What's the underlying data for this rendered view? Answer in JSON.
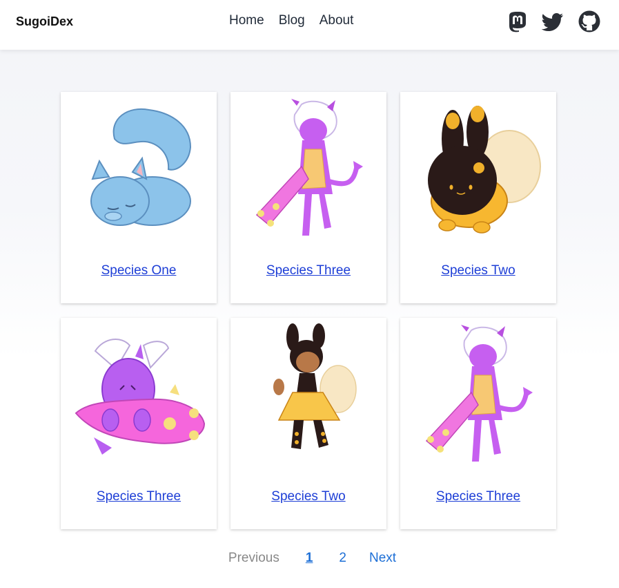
{
  "header": {
    "brand": "SugoiDex",
    "nav": [
      {
        "label": "Home"
      },
      {
        "label": "Blog"
      },
      {
        "label": "About"
      }
    ],
    "social_icons": [
      "mastodon-icon",
      "twitter-icon",
      "github-icon"
    ]
  },
  "cards": [
    {
      "title": "Species One",
      "image": "blue-cat-creature-illustration"
    },
    {
      "title": "Species Three",
      "image": "purple-horned-creature-with-club-illustration"
    },
    {
      "title": "Species Two",
      "image": "black-bunny-bee-creature-illustration"
    },
    {
      "title": "Species Three",
      "image": "purple-creature-hugging-club-illustration"
    },
    {
      "title": "Species Two",
      "image": "bee-girl-in-yellow-dress-illustration"
    },
    {
      "title": "Species Three",
      "image": "purple-horned-creature-with-club-illustration"
    }
  ],
  "pagination": {
    "previous": "Previous",
    "pages": [
      "1",
      "2"
    ],
    "current": "1",
    "next": "Next"
  },
  "colors": {
    "link": "#1d3ed6",
    "pager_link": "#1d6fd6",
    "pager_disabled": "#888888"
  }
}
